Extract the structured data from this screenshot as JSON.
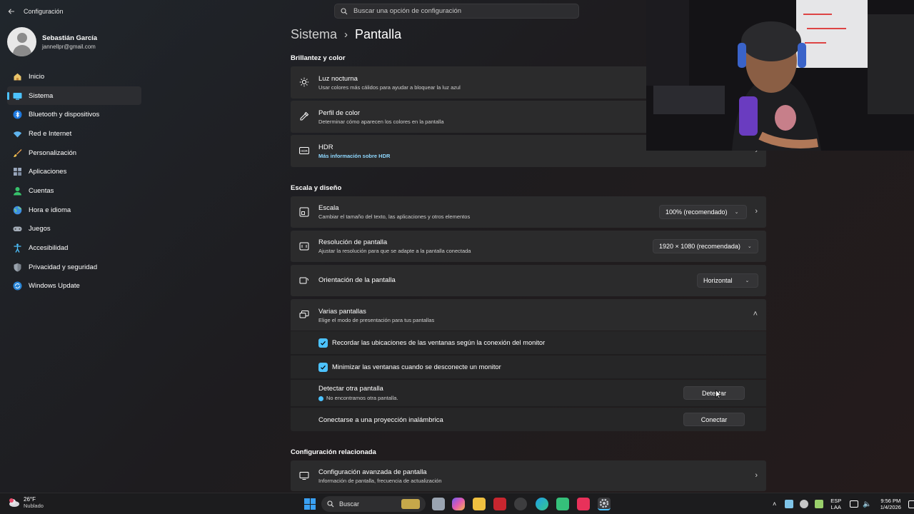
{
  "window": {
    "title": "Configuración"
  },
  "search": {
    "placeholder": "Buscar una opción de configuración"
  },
  "profile": {
    "name": "Sebastián García",
    "email": "jannellpr@gmail.com"
  },
  "sidebar": {
    "items": [
      {
        "label": "Inicio",
        "icon": "home-icon"
      },
      {
        "label": "Sistema",
        "icon": "monitor-icon",
        "active": true
      },
      {
        "label": "Bluetooth y dispositivos",
        "icon": "bluetooth-icon"
      },
      {
        "label": "Red e Internet",
        "icon": "wifi-icon"
      },
      {
        "label": "Personalización",
        "icon": "brush-icon"
      },
      {
        "label": "Aplicaciones",
        "icon": "apps-icon"
      },
      {
        "label": "Cuentas",
        "icon": "account-icon"
      },
      {
        "label": "Hora e idioma",
        "icon": "globe-clock-icon"
      },
      {
        "label": "Juegos",
        "icon": "gamepad-icon"
      },
      {
        "label": "Accesibilidad",
        "icon": "accessibility-icon"
      },
      {
        "label": "Privacidad y seguridad",
        "icon": "shield-icon"
      },
      {
        "label": "Windows Update",
        "icon": "update-icon"
      }
    ]
  },
  "header": {
    "parent": "Sistema",
    "separator": "›",
    "current": "Pantalla"
  },
  "sections": {
    "brightness": "Brillantez y color",
    "scale": "Escala y diseño",
    "related": "Configuración relacionada"
  },
  "cards": {
    "night_light": {
      "title": "Luz nocturna",
      "subtitle": "Usar colores más cálidos para ayudar a bloquear la luz azul"
    },
    "color_profile": {
      "title": "Perfil de color",
      "subtitle": "Determinar cómo aparecen los colores en la pantalla"
    },
    "hdr": {
      "title": "HDR",
      "link": "Más información sobre HDR",
      "icon_text": "HDR"
    },
    "scale": {
      "title": "Escala",
      "subtitle": "Cambiar el tamaño del texto, las aplicaciones y otros elementos",
      "value": "100% (recomendado)"
    },
    "resolution": {
      "title": "Resolución de pantalla",
      "subtitle": "Ajustar la resolución para que se adapte a la pantalla conectada",
      "value": "1920 × 1080 (recomendada)"
    },
    "orientation": {
      "title": "Orientación de la pantalla",
      "value": "Horizontal"
    },
    "multiple": {
      "title": "Varias pantallas",
      "subtitle": "Elige el modo de presentación para tus pantallas"
    },
    "advanced": {
      "title": "Configuración avanzada de pantalla",
      "subtitle": "Información de pantalla, frecuencia de actualización"
    }
  },
  "multiple_options": {
    "remember": "Recordar las ubicaciones de las ventanas según la conexión del monitor",
    "minimize": "Minimizar las ventanas cuando se desconecte un monitor",
    "detect_title": "Detectar otra pantalla",
    "detect_status": "No encontramos otra pantalla.",
    "detect_button": "Detectar",
    "wireless_title": "Conectarse a una proyección inalámbrica",
    "wireless_button": "Conectar"
  },
  "taskbar": {
    "weather_temp": "26°F",
    "weather_desc": "Nublado",
    "search_label": "Buscar",
    "lang_top": "ESP",
    "lang_bottom": "LAA",
    "time": "9:56 PM",
    "date": "1/4/2026"
  },
  "colors": {
    "accent": "#4cc2ff",
    "link": "#8fd8ff",
    "card": "#2b2b2c"
  }
}
